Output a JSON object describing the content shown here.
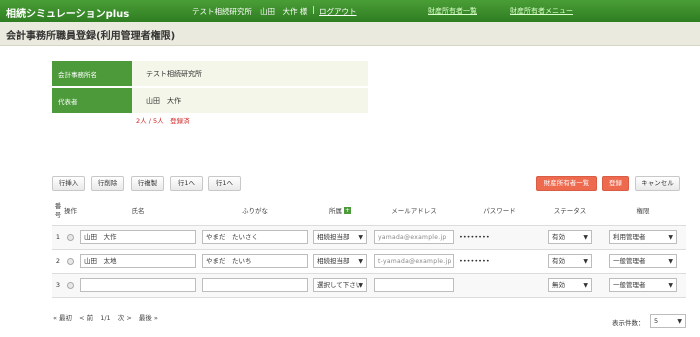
{
  "header": {
    "app_title": "相続シミュレーションplus",
    "office": "テスト相続研究所",
    "user": "山田　大作 様",
    "separator": "|",
    "logout": "ログアウト",
    "nav": [
      "財産所有者一覧",
      "財産所有者メニュー"
    ]
  },
  "page": {
    "title": "会計事務所職員登録(利用管理者権限)"
  },
  "info": {
    "office_label": "会計事務所名",
    "office_value": "テスト相続研究所",
    "rep_label": "代表者",
    "rep_value": "山田　大作",
    "count_text": "2人 / 5人　登録済"
  },
  "toolbar": {
    "insert_row": "行挿入",
    "delete_row": "行削除",
    "copy_row": "行複製",
    "row_up": "行1へ",
    "row_down": "行1へ",
    "owner_list": "財産所有者一覧",
    "register": "登録",
    "cancel": "キャンセル"
  },
  "table": {
    "headers": {
      "no": "番号",
      "op": "操作",
      "name": "氏名",
      "kana": "ふりがな",
      "dept": "所属",
      "email": "メールアドレス",
      "password": "パスワード",
      "status": "ステータス",
      "role": "権限"
    },
    "rows": [
      {
        "no": "1",
        "name": "山田　大作",
        "kana": "やまだ　たいさく",
        "dept": "相続担当部",
        "email": "yamada@example.jp",
        "password": "••••••••",
        "status": "有効",
        "role": "利用管理者"
      },
      {
        "no": "2",
        "name": "山田　太地",
        "kana": "やまだ　たいち",
        "dept": "相続担当部",
        "email": "t-yamada@example.jp",
        "password": "••••••••",
        "status": "有効",
        "role": "一般管理者"
      },
      {
        "no": "3",
        "name": "",
        "kana": "",
        "dept": "選択して下さい",
        "email": "",
        "password": "",
        "status": "無効",
        "role": "一般管理者"
      }
    ]
  },
  "pager": {
    "first": "« 最初",
    "prev": "< 前",
    "page": "1/1",
    "next": "次 >",
    "last": "最後 »"
  },
  "pagesize": {
    "label": "表示件数：",
    "value": "5"
  },
  "colors": {
    "green": "#3a8c2a",
    "red_button": "#ed6a4f",
    "count_red": "#d02020"
  }
}
